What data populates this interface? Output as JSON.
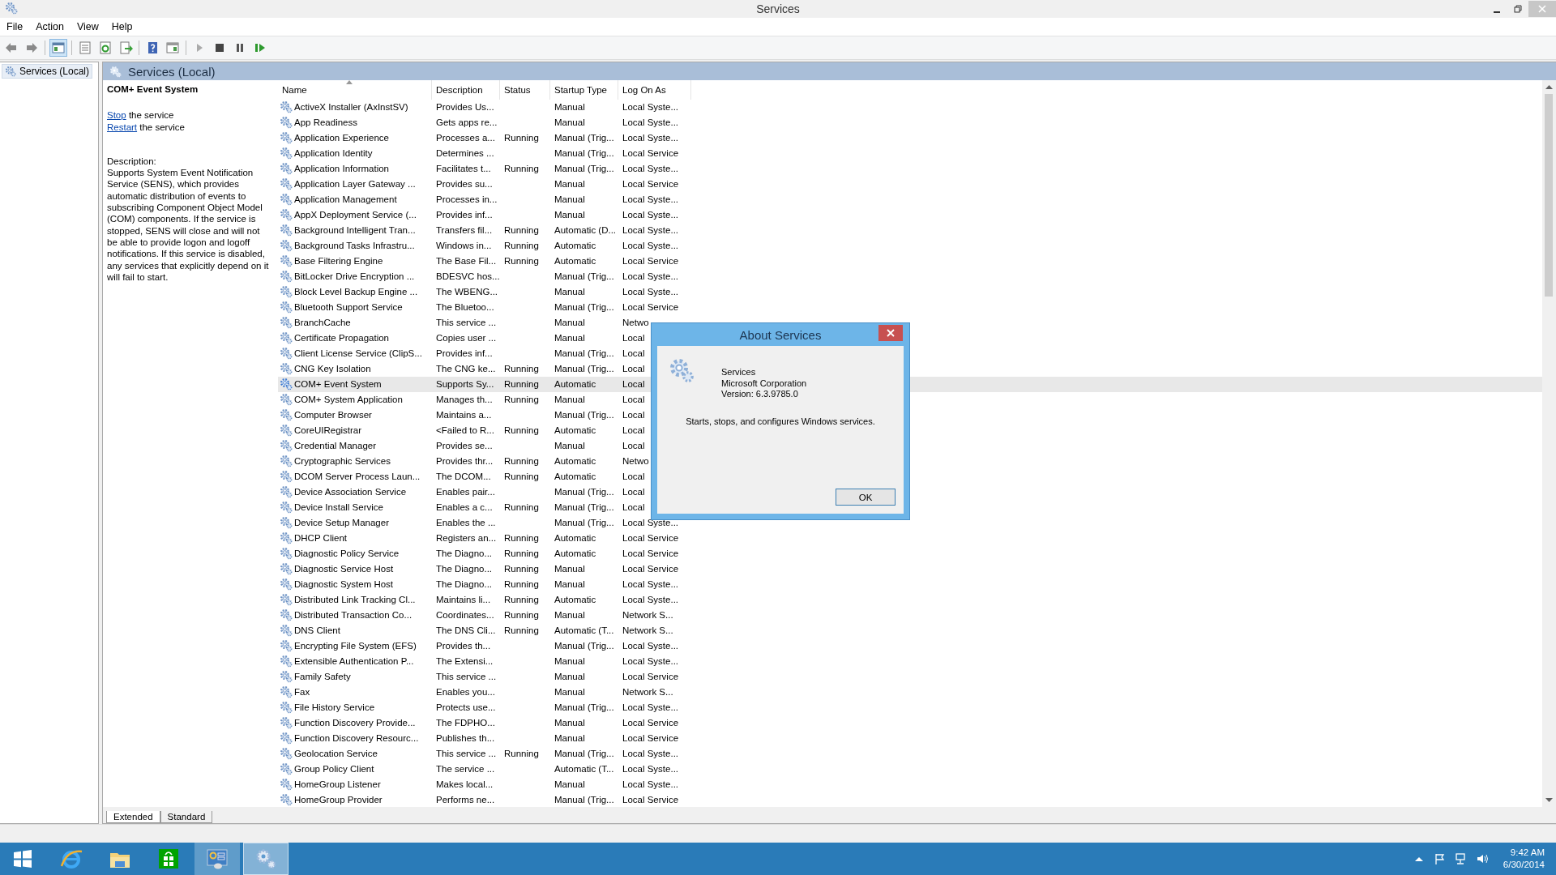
{
  "window": {
    "title": "Services"
  },
  "menu": [
    {
      "label": "File"
    },
    {
      "label": "Action"
    },
    {
      "label": "View"
    },
    {
      "label": "Help"
    }
  ],
  "toolbar": [
    {
      "kind": "back",
      "pressed": false
    },
    {
      "kind": "forward",
      "pressed": false
    },
    {
      "kind": "tree",
      "pressed": true
    },
    {
      "kind": "properties",
      "pressed": false
    },
    {
      "kind": "refresh",
      "pressed": false
    },
    {
      "kind": "export",
      "pressed": false
    },
    {
      "kind": "help",
      "pressed": false
    },
    {
      "kind": "actionpane",
      "pressed": false
    },
    {
      "kind": "play",
      "pressed": false
    },
    {
      "kind": "stop",
      "pressed": false
    },
    {
      "kind": "pause",
      "pressed": false
    },
    {
      "kind": "resume",
      "pressed": false
    }
  ],
  "tree": [
    {
      "label": "Services (Local)",
      "selected": true
    }
  ],
  "panel": {
    "title": "Services (Local)"
  },
  "details": {
    "service_name": "COM+ Event System",
    "actions": [
      {
        "link": "Stop",
        "text": "the service"
      },
      {
        "link": "Restart",
        "text": "the service"
      }
    ],
    "description_label": "Description:",
    "description": "Supports System Event Notification Service (SENS), which provides automatic distribution of events to subscribing Component Object Model (COM) components. If the service is stopped, SENS will close and will not be able to provide logon and logoff notifications. If this service is disabled, any services that explicitly depend on it will fail to start."
  },
  "table": {
    "columns": [
      {
        "label": "Name",
        "sorted": true
      },
      {
        "label": "Description",
        "sorted": false
      },
      {
        "label": "Status",
        "sorted": false
      },
      {
        "label": "Startup Type",
        "sorted": false
      },
      {
        "label": "Log On As",
        "sorted": false
      }
    ],
    "rows": [
      {
        "name": "ActiveX Installer (AxInstSV)",
        "description": "Provides Us...",
        "startup_type": "Manual",
        "log_on_as": "Local Syste...",
        "selected": false
      },
      {
        "name": "App Readiness",
        "description": "Gets apps re...",
        "startup_type": "Manual",
        "log_on_as": "Local Syste...",
        "selected": false
      },
      {
        "name": "Application Experience",
        "description": "Processes a...",
        "status": "Running",
        "startup_type": "Manual (Trig...",
        "log_on_as": "Local Syste...",
        "selected": false
      },
      {
        "name": "Application Identity",
        "description": "Determines ...",
        "startup_type": "Manual (Trig...",
        "log_on_as": "Local Service",
        "selected": false
      },
      {
        "name": "Application Information",
        "description": "Facilitates t...",
        "status": "Running",
        "startup_type": "Manual (Trig...",
        "log_on_as": "Local Syste...",
        "selected": false
      },
      {
        "name": "Application Layer Gateway ...",
        "description": "Provides su...",
        "startup_type": "Manual",
        "log_on_as": "Local Service",
        "selected": false
      },
      {
        "name": "Application Management",
        "description": "Processes in...",
        "startup_type": "Manual",
        "log_on_as": "Local Syste...",
        "selected": false
      },
      {
        "name": "AppX Deployment Service (...",
        "description": "Provides inf...",
        "startup_type": "Manual",
        "log_on_as": "Local Syste...",
        "selected": false
      },
      {
        "name": "Background Intelligent Tran...",
        "description": "Transfers fil...",
        "status": "Running",
        "startup_type": "Automatic (D...",
        "log_on_as": "Local Syste...",
        "selected": false
      },
      {
        "name": "Background Tasks Infrastru...",
        "description": "Windows in...",
        "status": "Running",
        "startup_type": "Automatic",
        "log_on_as": "Local Syste...",
        "selected": false
      },
      {
        "name": "Base Filtering Engine",
        "description": "The Base Fil...",
        "status": "Running",
        "startup_type": "Automatic",
        "log_on_as": "Local Service",
        "selected": false
      },
      {
        "name": "BitLocker Drive Encryption ...",
        "description": "BDESVC hos...",
        "startup_type": "Manual (Trig...",
        "log_on_as": "Local Syste...",
        "selected": false
      },
      {
        "name": "Block Level Backup Engine ...",
        "description": "The WBENG...",
        "startup_type": "Manual",
        "log_on_as": "Local Syste...",
        "selected": false
      },
      {
        "name": "Bluetooth Support Service",
        "description": "The Bluetoo...",
        "startup_type": "Manual (Trig...",
        "log_on_as": "Local Service",
        "selected": false
      },
      {
        "name": "BranchCache",
        "description": "This service ...",
        "startup_type": "Manual",
        "log_on_as": "Netwo",
        "selected": false
      },
      {
        "name": "Certificate Propagation",
        "description": "Copies user ...",
        "startup_type": "Manual",
        "log_on_as": "Local",
        "selected": false
      },
      {
        "name": "Client License Service (ClipS...",
        "description": "Provides inf...",
        "startup_type": "Manual (Trig...",
        "log_on_as": "Local",
        "selected": false
      },
      {
        "name": "CNG Key Isolation",
        "description": "The CNG ke...",
        "status": "Running",
        "startup_type": "Manual (Trig...",
        "log_on_as": "Local",
        "selected": false
      },
      {
        "name": "COM+ Event System",
        "description": "Supports Sy...",
        "status": "Running",
        "startup_type": "Automatic",
        "log_on_as": "Local",
        "selected": true
      },
      {
        "name": "COM+ System Application",
        "description": "Manages th...",
        "status": "Running",
        "startup_type": "Manual",
        "log_on_as": "Local",
        "selected": false
      },
      {
        "name": "Computer Browser",
        "description": "Maintains a...",
        "startup_type": "Manual (Trig...",
        "log_on_as": "Local",
        "selected": false
      },
      {
        "name": "CoreUIRegistrar",
        "description": "<Failed to R...",
        "status": "Running",
        "startup_type": "Automatic",
        "log_on_as": "Local",
        "selected": false
      },
      {
        "name": "Credential Manager",
        "description": "Provides se...",
        "startup_type": "Manual",
        "log_on_as": "Local",
        "selected": false
      },
      {
        "name": "Cryptographic Services",
        "description": "Provides thr...",
        "status": "Running",
        "startup_type": "Automatic",
        "log_on_as": "Netwo",
        "selected": false
      },
      {
        "name": "DCOM Server Process Laun...",
        "description": "The DCOM...",
        "status": "Running",
        "startup_type": "Automatic",
        "log_on_as": "Local",
        "selected": false
      },
      {
        "name": "Device Association Service",
        "description": "Enables pair...",
        "startup_type": "Manual (Trig...",
        "log_on_as": "Local",
        "selected": false
      },
      {
        "name": "Device Install Service",
        "description": "Enables a c...",
        "status": "Running",
        "startup_type": "Manual (Trig...",
        "log_on_as": "Local",
        "selected": false
      },
      {
        "name": "Device Setup Manager",
        "description": "Enables the ...",
        "startup_type": "Manual (Trig...",
        "log_on_as": "Local Syste...",
        "selected": false
      },
      {
        "name": "DHCP Client",
        "description": "Registers an...",
        "status": "Running",
        "startup_type": "Automatic",
        "log_on_as": "Local Service",
        "selected": false
      },
      {
        "name": "Diagnostic Policy Service",
        "description": "The Diagno...",
        "status": "Running",
        "startup_type": "Automatic",
        "log_on_as": "Local Service",
        "selected": false
      },
      {
        "name": "Diagnostic Service Host",
        "description": "The Diagno...",
        "status": "Running",
        "startup_type": "Manual",
        "log_on_as": "Local Service",
        "selected": false
      },
      {
        "name": "Diagnostic System Host",
        "description": "The Diagno...",
        "status": "Running",
        "startup_type": "Manual",
        "log_on_as": "Local Syste...",
        "selected": false
      },
      {
        "name": "Distributed Link Tracking Cl...",
        "description": "Maintains li...",
        "status": "Running",
        "startup_type": "Automatic",
        "log_on_as": "Local Syste...",
        "selected": false
      },
      {
        "name": "Distributed Transaction Co...",
        "description": "Coordinates...",
        "status": "Running",
        "startup_type": "Manual",
        "log_on_as": "Network S...",
        "selected": false
      },
      {
        "name": "DNS Client",
        "description": "The DNS Cli...",
        "status": "Running",
        "startup_type": "Automatic (T...",
        "log_on_as": "Network S...",
        "selected": false
      },
      {
        "name": "Encrypting File System (EFS)",
        "description": "Provides th...",
        "startup_type": "Manual (Trig...",
        "log_on_as": "Local Syste...",
        "selected": false
      },
      {
        "name": "Extensible Authentication P...",
        "description": "The Extensi...",
        "startup_type": "Manual",
        "log_on_as": "Local Syste...",
        "selected": false
      },
      {
        "name": "Family Safety",
        "description": "This service ...",
        "startup_type": "Manual",
        "log_on_as": "Local Service",
        "selected": false
      },
      {
        "name": "Fax",
        "description": "Enables you...",
        "startup_type": "Manual",
        "log_on_as": "Network S...",
        "selected": false
      },
      {
        "name": "File History Service",
        "description": "Protects use...",
        "startup_type": "Manual (Trig...",
        "log_on_as": "Local Syste...",
        "selected": false
      },
      {
        "name": "Function Discovery Provide...",
        "description": "The FDPHO...",
        "startup_type": "Manual",
        "log_on_as": "Local Service",
        "selected": false
      },
      {
        "name": "Function Discovery Resourc...",
        "description": "Publishes th...",
        "startup_type": "Manual",
        "log_on_as": "Local Service",
        "selected": false
      },
      {
        "name": "Geolocation Service",
        "description": "This service ...",
        "status": "Running",
        "startup_type": "Manual (Trig...",
        "log_on_as": "Local Syste...",
        "selected": false
      },
      {
        "name": "Group Policy Client",
        "description": "The service ...",
        "startup_type": "Automatic (T...",
        "log_on_as": "Local Syste...",
        "selected": false
      },
      {
        "name": "HomeGroup Listener",
        "description": "Makes local...",
        "startup_type": "Manual",
        "log_on_as": "Local Syste...",
        "selected": false
      },
      {
        "name": "HomeGroup Provider",
        "description": "Performs ne...",
        "startup_type": "Manual (Trig...",
        "log_on_as": "Local Service",
        "selected": false
      }
    ]
  },
  "view_tabs": [
    {
      "label": "Extended",
      "selected": true
    },
    {
      "label": "Standard",
      "selected": false
    }
  ],
  "dialog": {
    "title": "About Services",
    "product": "Services",
    "company": "Microsoft Corporation",
    "version": "Version: 6.3.9785.0",
    "summary": "Starts, stops, and configures Windows services.",
    "ok_button": "OK"
  },
  "taskbar": {
    "apps": [
      {
        "kind": "start",
        "open": false,
        "selected": false
      },
      {
        "kind": "browser",
        "open": false,
        "selected": false
      },
      {
        "kind": "folder",
        "open": false,
        "selected": false
      },
      {
        "kind": "store",
        "open": false,
        "selected": false
      },
      {
        "kind": "panel",
        "open": true,
        "selected": false
      },
      {
        "kind": "gears",
        "open": true,
        "selected": true
      }
    ],
    "tray": [
      {
        "kind": "chevron"
      },
      {
        "kind": "flag"
      },
      {
        "kind": "network"
      },
      {
        "kind": "volume"
      }
    ],
    "time": "9:42 AM",
    "date": "6/30/2014"
  }
}
